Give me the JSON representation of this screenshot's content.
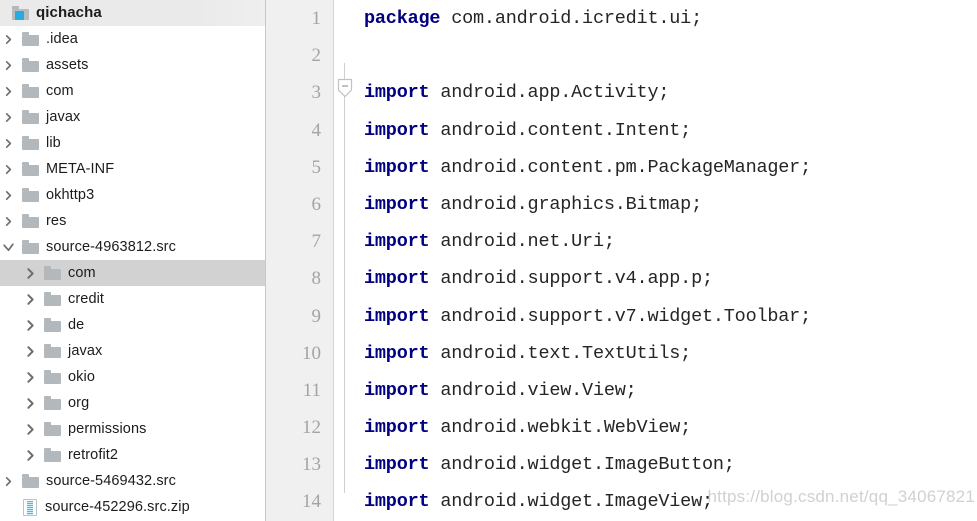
{
  "window": {
    "title": "qichacha"
  },
  "sidebar": {
    "root": {
      "label": "qichacha",
      "icon": "folder-accent-icon",
      "expanded": true,
      "selected": true
    },
    "items": [
      {
        "label": ".idea",
        "icon": "folder-icon",
        "level": 1,
        "state": "collapsed",
        "selected": false
      },
      {
        "label": "assets",
        "icon": "folder-icon",
        "level": 1,
        "state": "collapsed",
        "selected": false
      },
      {
        "label": "com",
        "icon": "folder-icon",
        "level": 1,
        "state": "collapsed",
        "selected": false
      },
      {
        "label": "javax",
        "icon": "folder-icon",
        "level": 1,
        "state": "collapsed",
        "selected": false
      },
      {
        "label": "lib",
        "icon": "folder-icon",
        "level": 1,
        "state": "collapsed",
        "selected": false
      },
      {
        "label": "META-INF",
        "icon": "folder-icon",
        "level": 1,
        "state": "collapsed",
        "selected": false
      },
      {
        "label": "okhttp3",
        "icon": "folder-icon",
        "level": 1,
        "state": "collapsed",
        "selected": false
      },
      {
        "label": "res",
        "icon": "folder-icon",
        "level": 1,
        "state": "collapsed",
        "selected": false
      },
      {
        "label": "source-4963812.src",
        "icon": "folder-icon",
        "level": 1,
        "state": "expanded",
        "selected": false
      },
      {
        "label": "com",
        "icon": "folder-icon",
        "level": 2,
        "state": "collapsed",
        "selected": true
      },
      {
        "label": "credit",
        "icon": "folder-icon",
        "level": 2,
        "state": "collapsed",
        "selected": false
      },
      {
        "label": "de",
        "icon": "folder-icon",
        "level": 2,
        "state": "collapsed",
        "selected": false
      },
      {
        "label": "javax",
        "icon": "folder-icon",
        "level": 2,
        "state": "collapsed",
        "selected": false
      },
      {
        "label": "okio",
        "icon": "folder-icon",
        "level": 2,
        "state": "collapsed",
        "selected": false
      },
      {
        "label": "org",
        "icon": "folder-icon",
        "level": 2,
        "state": "collapsed",
        "selected": false
      },
      {
        "label": "permissions",
        "icon": "folder-icon",
        "level": 2,
        "state": "collapsed",
        "selected": false
      },
      {
        "label": "retrofit2",
        "icon": "folder-icon",
        "level": 2,
        "state": "collapsed",
        "selected": false
      },
      {
        "label": "source-5469432.src",
        "icon": "folder-icon",
        "level": 1,
        "state": "collapsed",
        "selected": false
      },
      {
        "label": "source-452296.src.zip",
        "icon": "zip-icon",
        "level": 1,
        "state": "none",
        "selected": false
      }
    ]
  },
  "editor": {
    "line_numbers": [
      "1",
      "2",
      "3",
      "4",
      "5",
      "6",
      "7",
      "8",
      "9",
      "10",
      "11",
      "12",
      "13",
      "14"
    ],
    "fold_marker": "fold-collapse-icon",
    "lines": [
      {
        "keyword": "package",
        "rest": " com.android.icredit.ui;"
      },
      {
        "keyword": "",
        "rest": ""
      },
      {
        "keyword": "import",
        "rest": " android.app.Activity;"
      },
      {
        "keyword": "import",
        "rest": " android.content.Intent;"
      },
      {
        "keyword": "import",
        "rest": " android.content.pm.PackageManager;"
      },
      {
        "keyword": "import",
        "rest": " android.graphics.Bitmap;"
      },
      {
        "keyword": "import",
        "rest": " android.net.Uri;"
      },
      {
        "keyword": "import",
        "rest": " android.support.v4.app.p;"
      },
      {
        "keyword": "import",
        "rest": " android.support.v7.widget.Toolbar;"
      },
      {
        "keyword": "import",
        "rest": " android.text.TextUtils;"
      },
      {
        "keyword": "import",
        "rest": " android.view.View;"
      },
      {
        "keyword": "import",
        "rest": " android.webkit.WebView;"
      },
      {
        "keyword": "import",
        "rest": " android.widget.ImageButton;"
      },
      {
        "keyword": "import",
        "rest": " android.widget.ImageView;"
      }
    ],
    "watermark": "https://blog.csdn.net/qq_34067821"
  },
  "colors": {
    "keyword": "#000080",
    "code_text": "#252525",
    "gutter_bg": "#f0f0f0",
    "line_number": "#a4a4a4",
    "selection": "#d2d2d2",
    "folder": "#b2b8bc",
    "accent": "#29abe2"
  }
}
